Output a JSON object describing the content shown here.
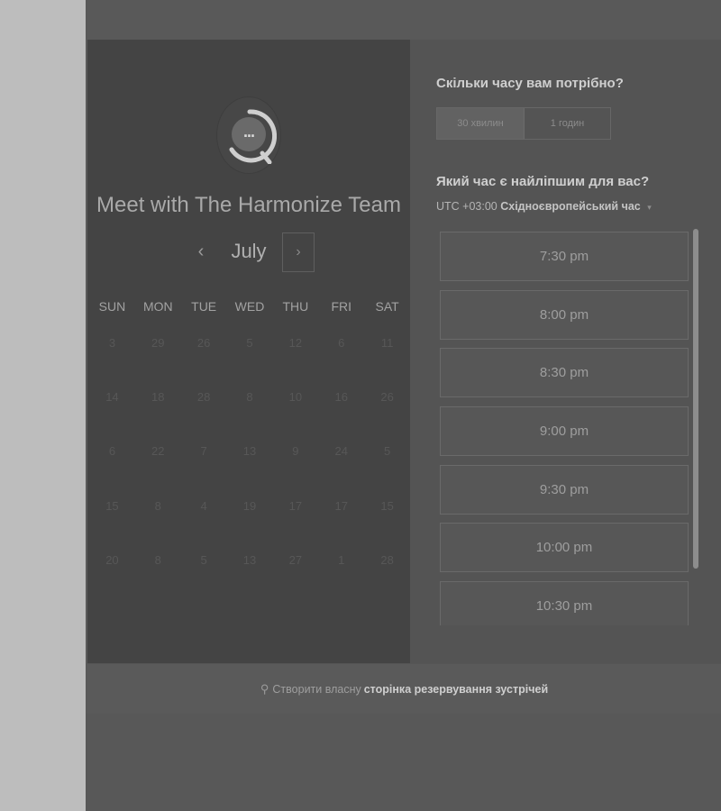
{
  "calendar": {
    "title": "Meet with The Harmonize Team",
    "month": "July",
    "prev_icon": "‹",
    "next_icon": "›",
    "avatar_icon": "...",
    "weekdays": [
      "SUN",
      "MON",
      "TUE",
      "WED",
      "THU",
      "FRI",
      "SAT"
    ],
    "weeks": [
      [
        "3",
        "29",
        "26",
        "5",
        "12",
        "6",
        "11"
      ],
      [
        "14",
        "18",
        "28",
        "8",
        "10",
        "16",
        "26"
      ],
      [
        "6",
        "22",
        "7",
        "13",
        "9",
        "24",
        "5"
      ],
      [
        "15",
        "8",
        "4",
        "19",
        "17",
        "17",
        "15"
      ],
      [
        "20",
        "8",
        "5",
        "13",
        "27",
        "1",
        "28"
      ]
    ]
  },
  "times": {
    "duration_question": "Скільки часу вам потрібно?",
    "duration_options": [
      "30 хвилин",
      "1 годин"
    ],
    "selected_duration": "30 хвилин",
    "time_question": "Який час є найліпшим для вас?",
    "timezone_offset": "UTC +03:00",
    "timezone_name": "Східноєвропейський час",
    "timezone_caret": "▾",
    "slots": [
      "7:30 pm",
      "8:00 pm",
      "8:30 pm",
      "9:00 pm",
      "9:30 pm",
      "10:00 pm",
      "10:30 pm"
    ]
  },
  "footer": {
    "icon": "⚲",
    "prefix": "Створити власну",
    "link": "сторінка резервування зустрічей"
  }
}
